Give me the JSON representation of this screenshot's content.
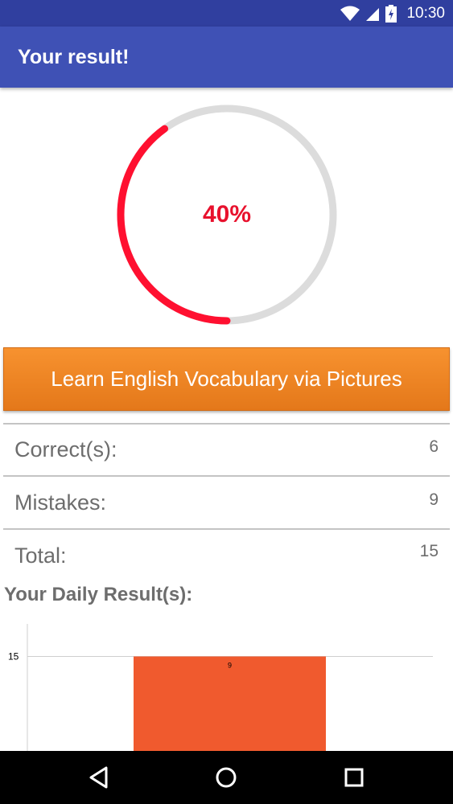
{
  "status_bar": {
    "time": "10:30"
  },
  "app_bar": {
    "title": "Your result!"
  },
  "score": {
    "percent_label": "40%",
    "fraction": 0.4
  },
  "learn_button": {
    "label": "Learn English Vocabulary via Pictures"
  },
  "stats": {
    "correct": {
      "label": "Correct(s):",
      "value": "6"
    },
    "mistakes": {
      "label": "Mistakes:",
      "value": "9"
    },
    "total": {
      "label": "Total:",
      "value": "15"
    }
  },
  "daily": {
    "title": "Your Daily Result(s):"
  },
  "chart_data": {
    "type": "bar",
    "y_ticks": [
      "15"
    ],
    "y_tick_values": [
      15
    ],
    "ylim": [
      0,
      18.5
    ],
    "bars": [
      {
        "value": 15,
        "label": "9",
        "color": "#f05a2e"
      }
    ],
    "grid": true
  },
  "colors": {
    "primary": "#3f51b5",
    "primary_dark": "#303f9f",
    "accent_red": "#e8112d",
    "button_orange": "#f0861f",
    "ring_track": "#dcdcdc"
  }
}
